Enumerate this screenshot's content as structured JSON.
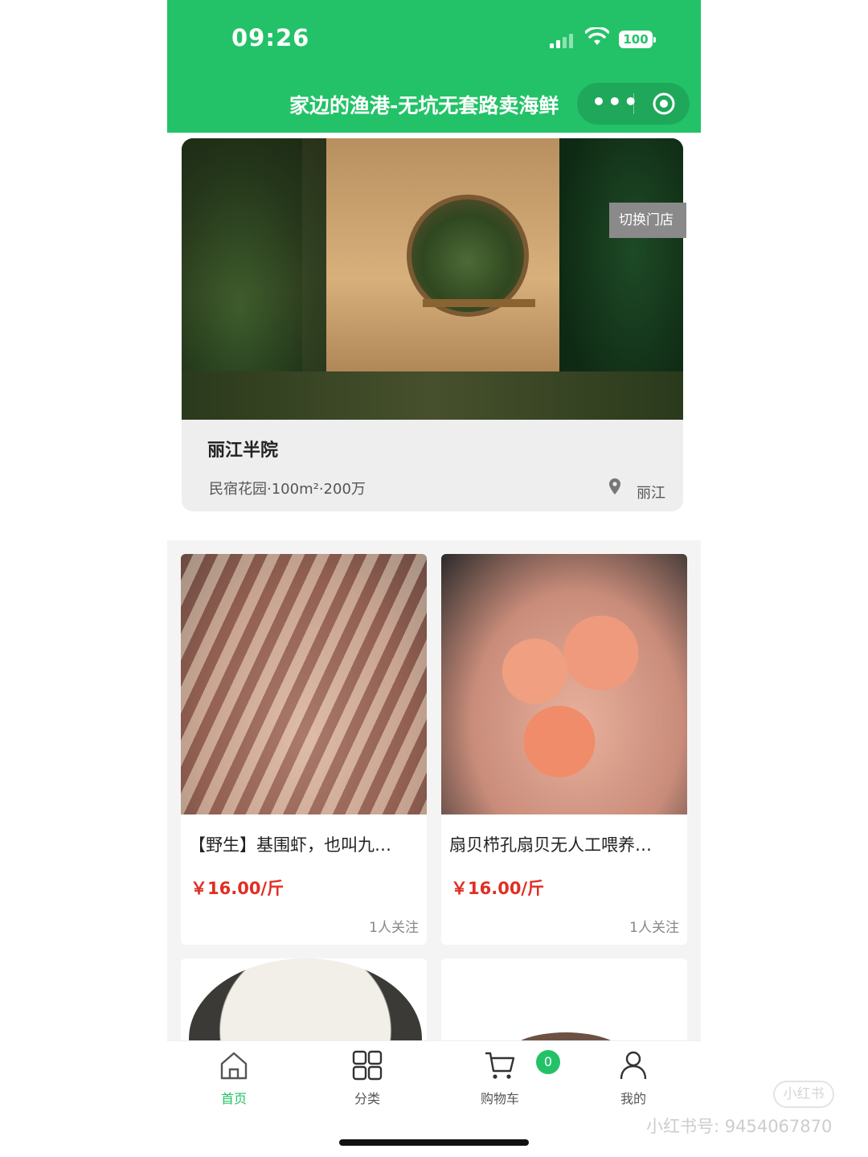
{
  "status_bar": {
    "time": "09:26",
    "battery": "100"
  },
  "nav": {
    "title": "家边的渔港-无坑无套路卖海鲜",
    "more_label": "•••"
  },
  "store": {
    "name": "丽江半院",
    "description": "民宿花园·100m²·200万",
    "city": "丽江",
    "switch_label": "切换门店"
  },
  "products": [
    {
      "title": "【野生】基围虾，也叫九…",
      "price": "￥16.00/斤",
      "follow": "1人关注"
    },
    {
      "title": "扇贝栉孔扇贝无人工喂养…",
      "price": "￥16.00/斤",
      "follow": "1人关注"
    }
  ],
  "tabs": [
    {
      "label": "首页",
      "icon": "home-icon",
      "active": true
    },
    {
      "label": "分类",
      "icon": "grid-icon",
      "active": false
    },
    {
      "label": "购物车",
      "icon": "cart-icon",
      "active": false
    },
    {
      "label": "我的",
      "icon": "user-icon",
      "active": false
    }
  ],
  "cart_count": "0",
  "watermark": {
    "logo": "小红书",
    "id": "小红书号: 9454067870"
  },
  "colors": {
    "brand_green": "#23c268",
    "price_red": "#e02e24"
  }
}
